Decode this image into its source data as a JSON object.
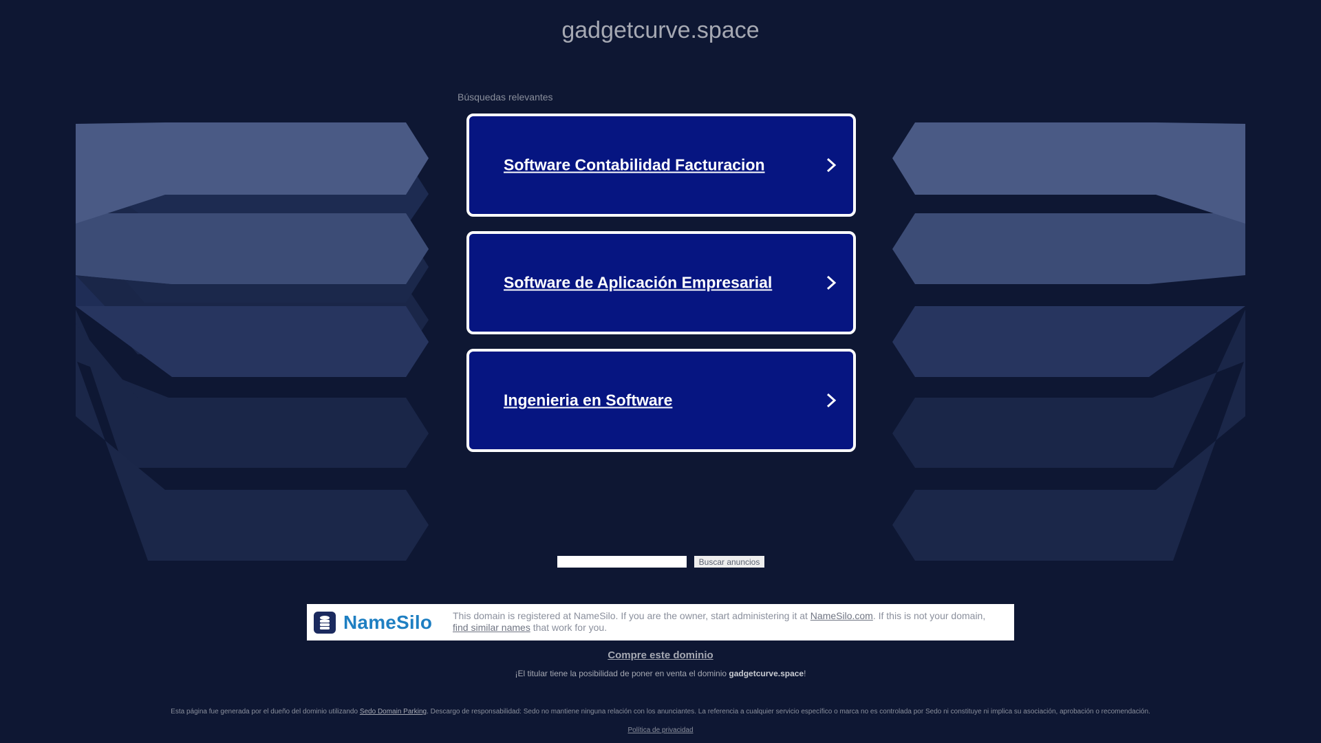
{
  "header": {
    "domain": "gadgetcurve.space"
  },
  "ads": {
    "section_label": "Búsquedas relevantes",
    "items": [
      {
        "label": "Software Contabilidad Facturacion"
      },
      {
        "label": "Software de Aplicación Empresarial"
      },
      {
        "label": "Ingenieria en Software"
      }
    ]
  },
  "search": {
    "input_value": "",
    "button_label": "Buscar anuncios"
  },
  "registrar": {
    "logo_text": "NameSilo",
    "text_before": "This domain is registered at NameSilo. If you are the owner, start administering it at ",
    "link_1": "NameSilo.com",
    "text_middle": ". If this is not your domain, ",
    "link_2": "find similar names",
    "text_after": " that work for you."
  },
  "sale": {
    "buy_link": "Compre este dominio",
    "note_before": "¡El titular tiene la posibilidad de poner en venta el dominio ",
    "note_domain": "gadgetcurve.space",
    "note_after": "!"
  },
  "footer": {
    "disclaimer_before": "Esta página fue generada por el dueño del dominio utilizando ",
    "disclaimer_link": "Sedo Domain Parking",
    "disclaimer_after": ". Descargo de responsabilidad: Sedo no mantiene ninguna relación con los anunciantes. La referencia a cualquier servicio específico o marca no es controlada por Sedo ni constituye ni implica su asociación, aprobación o recomendación.",
    "privacy_link": "Política de privacidad"
  },
  "colors": {
    "background": "#0e1733",
    "card": "#061581",
    "card_border": "#ffffff"
  }
}
